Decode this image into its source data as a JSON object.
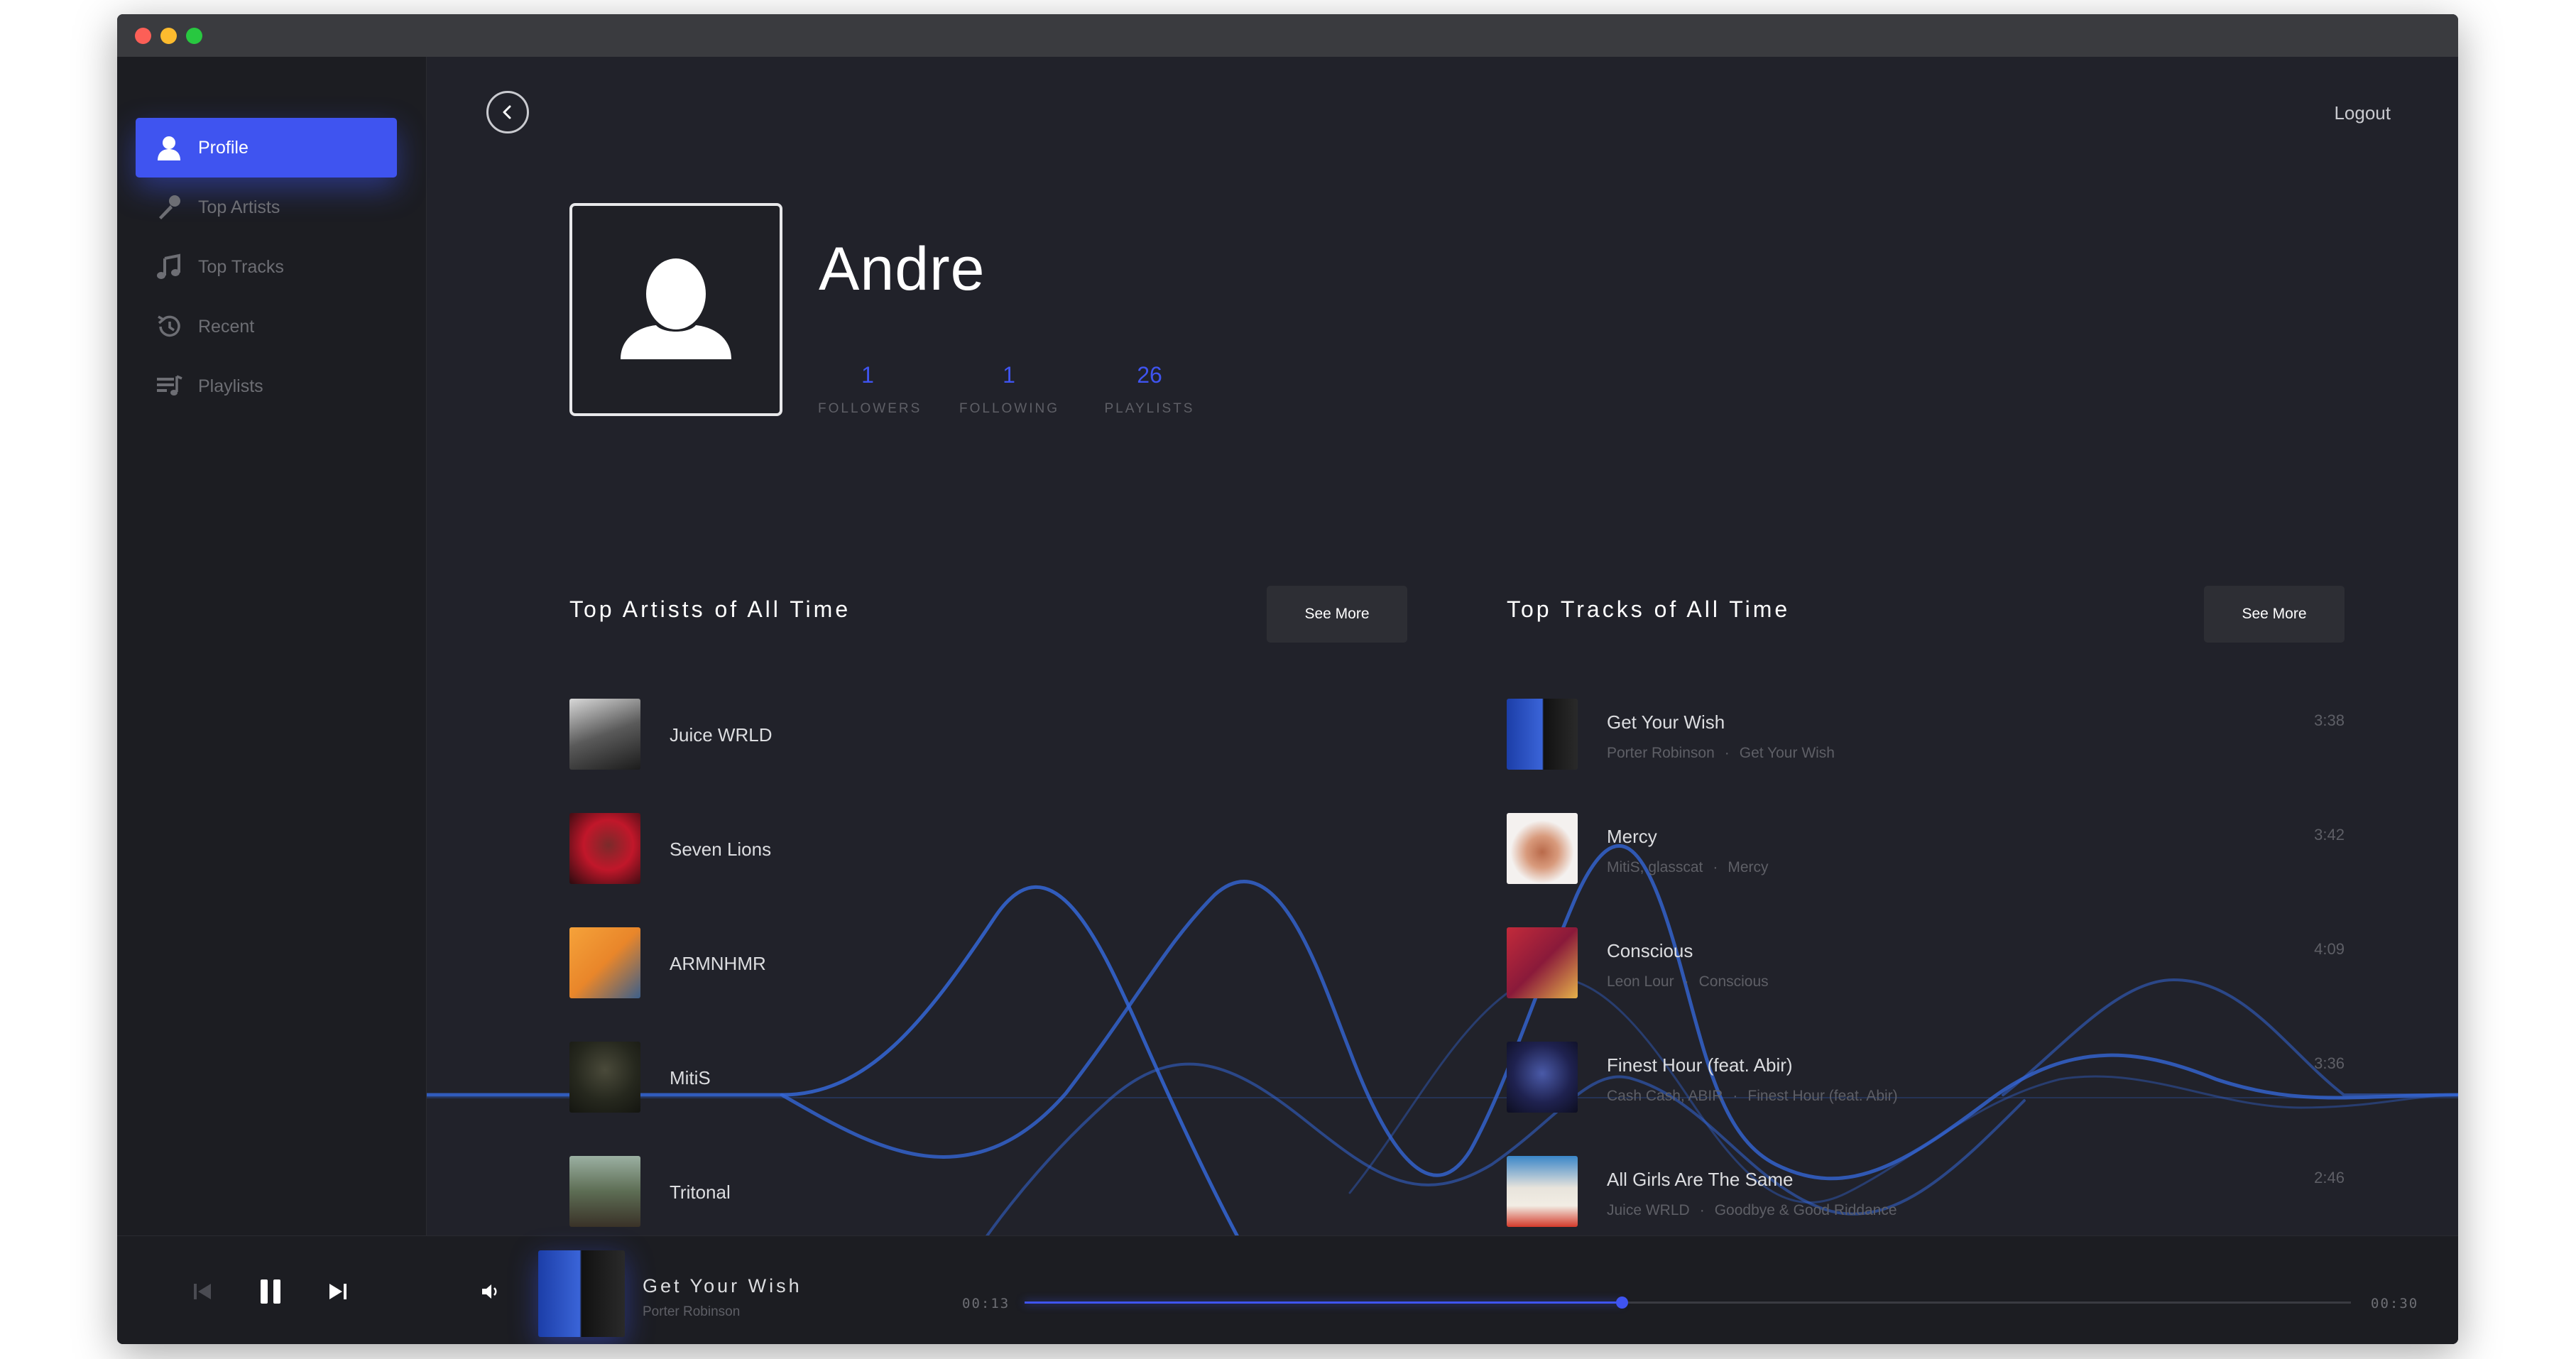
{
  "colors": {
    "accent": "#3f54f0",
    "background": "#21222a",
    "sidebar": "#1c1d22",
    "text": "#dcdde0",
    "muted": "#5e5f66"
  },
  "sidebar": {
    "items": [
      {
        "label": "Profile",
        "icon": "user-icon",
        "active": true
      },
      {
        "label": "Top Artists",
        "icon": "microphone-icon",
        "active": false
      },
      {
        "label": "Top Tracks",
        "icon": "music-note-icon",
        "active": false
      },
      {
        "label": "Recent",
        "icon": "history-icon",
        "active": false
      },
      {
        "label": "Playlists",
        "icon": "playlist-icon",
        "active": false
      }
    ]
  },
  "header": {
    "logout": "Logout"
  },
  "profile": {
    "name": "Andre",
    "stats": [
      {
        "value": "1",
        "label": "FOLLOWERS"
      },
      {
        "value": "1",
        "label": "FOLLOWING"
      },
      {
        "value": "26",
        "label": "PLAYLISTS"
      }
    ]
  },
  "top_artists": {
    "title": "Top Artists of All Time",
    "see_more": "See More",
    "items": [
      "Juice WRLD",
      "Seven Lions",
      "ARMNHMR",
      "MitiS",
      "Tritonal"
    ]
  },
  "top_tracks": {
    "title": "Top Tracks of All Time",
    "see_more": "See More",
    "items": [
      {
        "name": "Get Your Wish",
        "artist": "Porter Robinson",
        "album": "Get Your Wish",
        "duration": "3:38"
      },
      {
        "name": "Mercy",
        "artist": "MitiS, glasscat",
        "album": "Mercy",
        "duration": "3:42"
      },
      {
        "name": "Conscious",
        "artist": "Leon Lour",
        "album": "Conscious",
        "duration": "4:09"
      },
      {
        "name": "Finest Hour (feat. Abir)",
        "artist": "Cash Cash, ABIR",
        "album": "Finest Hour (feat. Abir)",
        "duration": "3:36"
      },
      {
        "name": "All Girls Are The Same",
        "artist": "Juice WRLD",
        "album": "Goodbye & Good Riddance",
        "duration": "2:46"
      }
    ]
  },
  "player": {
    "title": "Get Your Wish",
    "artist": "Porter Robinson",
    "elapsed": "00:13",
    "total": "00:30",
    "progress": 0.45,
    "state": "playing"
  }
}
